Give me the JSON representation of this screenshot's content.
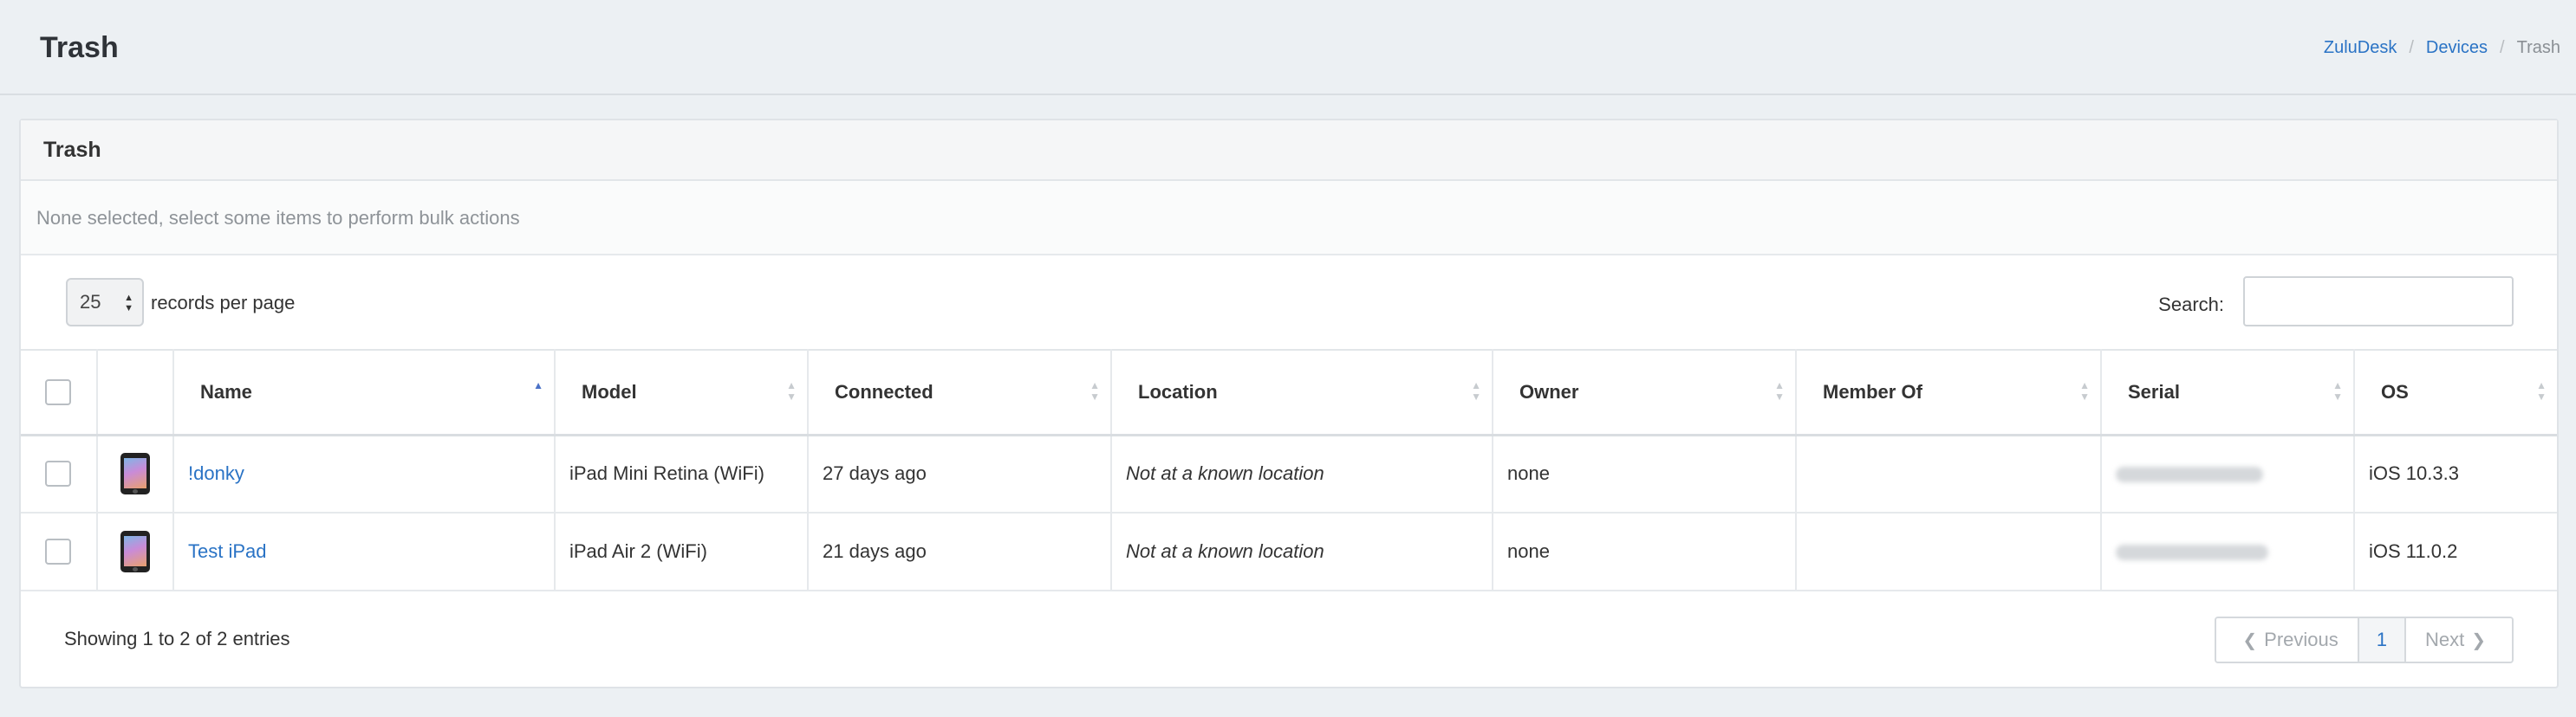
{
  "header": {
    "title": "Trash",
    "breadcrumb": [
      "ZuluDesk",
      "Devices",
      "Trash"
    ]
  },
  "panel": {
    "title": "Trash",
    "bulk_text": "None selected, select some items to perform bulk actions"
  },
  "controls": {
    "page_length": "25",
    "length_label": "records per page",
    "search_label": "Search:",
    "search_value": ""
  },
  "table": {
    "columns": [
      "Name",
      "Model",
      "Connected",
      "Location",
      "Owner",
      "Member Of",
      "Serial",
      "OS"
    ],
    "sorted_column": "Name",
    "rows": [
      {
        "name": "!donky",
        "model": "iPad Mini Retina (WiFi)",
        "connected": "27 days ago",
        "location": "Not at a known location",
        "owner": "none",
        "member_of": "",
        "serial": "",
        "os": "iOS 10.3.3",
        "icon": "ipad-icon"
      },
      {
        "name": "Test iPad",
        "model": "iPad Air 2 (WiFi)",
        "connected": "21 days ago",
        "location": "Not at a known location",
        "owner": "none",
        "member_of": "",
        "serial": "",
        "os": "iOS 11.0.2",
        "icon": "ipad-icon"
      }
    ]
  },
  "footer": {
    "info": "Showing 1 to 2 of 2 entries",
    "previous": "Previous",
    "current_page": "1",
    "next": "Next"
  },
  "colors": {
    "background": "#ecf0f3",
    "link": "#2a73c5",
    "sort_active": "#4b72c7"
  }
}
